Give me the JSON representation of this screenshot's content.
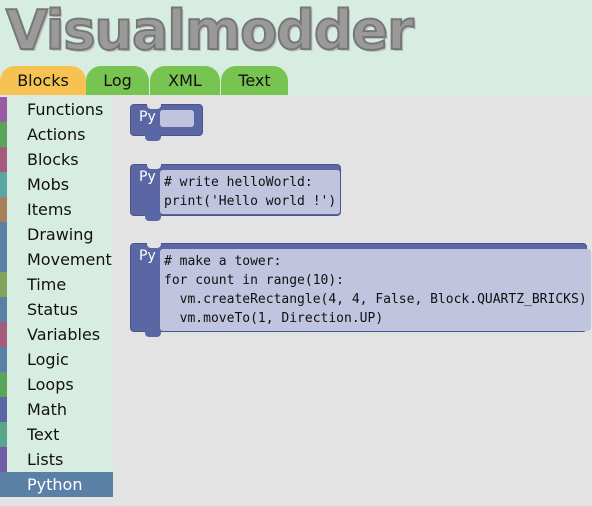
{
  "app": {
    "logo": "Visualmodder"
  },
  "tabs": [
    {
      "label": "Blocks",
      "active": true
    },
    {
      "label": "Log",
      "active": false
    },
    {
      "label": "XML",
      "active": false
    },
    {
      "label": "Text",
      "active": false
    }
  ],
  "toolbox": {
    "categories": [
      {
        "label": "Functions",
        "color": "#995ba5"
      },
      {
        "label": "Actions",
        "color": "#5ba55b"
      },
      {
        "label": "Blocks",
        "color": "#a55b80"
      },
      {
        "label": "Mobs",
        "color": "#5ba5a5"
      },
      {
        "label": "Items",
        "color": "#a5805b"
      },
      {
        "label": "Drawing",
        "color": "#5b80a5"
      },
      {
        "label": "Movement",
        "color": "#5b80a5"
      },
      {
        "label": "Time",
        "color": "#80a55b"
      },
      {
        "label": "Status",
        "color": "#5b80a5"
      },
      {
        "label": "Variables",
        "color": "#a55b80"
      },
      {
        "label": "Logic",
        "color": "#5b80a5"
      },
      {
        "label": "Loops",
        "color": "#5ba55b"
      },
      {
        "label": "Math",
        "color": "#5b67a5"
      },
      {
        "label": "Text",
        "color": "#5ba58c"
      },
      {
        "label": "Lists",
        "color": "#745ba5"
      },
      {
        "label": "Python",
        "color": "#5b80a5",
        "selected": true
      }
    ]
  },
  "blocks": [
    {
      "prefix": "Py",
      "code": ""
    },
    {
      "prefix": "Py",
      "code": "# write helloWorld:\nprint('Hello world !')"
    },
    {
      "prefix": "Py",
      "code": "# make a tower:\nfor count in range(10):\n  vm.createRectangle(4, 4, False, Block.QUARTZ_BRICKS)\n  vm.moveTo(1, Direction.UP)"
    }
  ]
}
